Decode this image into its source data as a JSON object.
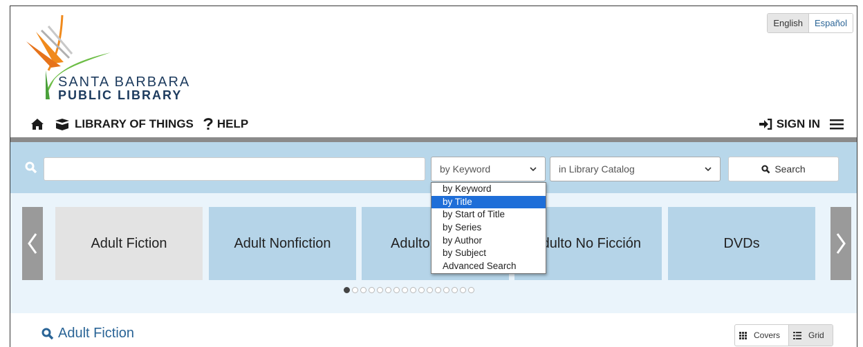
{
  "language": {
    "active": "English",
    "other": "Español"
  },
  "logo": {
    "line1": "SANTA BARBARA",
    "line2": "PUBLIC LIBRARY"
  },
  "nav": {
    "library_of_things": "LIBRARY OF THINGS",
    "help": "HELP",
    "sign_in": "SIGN IN"
  },
  "search": {
    "query": "",
    "by_selected": "by Keyword",
    "in_selected": "in Library Catalog",
    "button": "Search",
    "by_options": [
      "by Keyword",
      "by Title",
      "by Start of Title",
      "by Series",
      "by Author",
      "by Subject",
      "Advanced Search"
    ],
    "highlighted_option": "by Title"
  },
  "carousel": {
    "tiles": [
      "Adult Fiction",
      "Adult Nonfiction",
      "Adulto",
      "dulto No Ficción",
      "DVDs"
    ],
    "dot_count": 16,
    "active_dot": 1
  },
  "section": {
    "title": "Adult Fiction"
  },
  "view": {
    "covers": "Covers",
    "grid": "Grid",
    "active": "Grid"
  },
  "colors": {
    "link": "#2a6496",
    "band": "#b8d7ea",
    "tile": "#b5d4e8",
    "highlight": "#1e6ed8"
  }
}
